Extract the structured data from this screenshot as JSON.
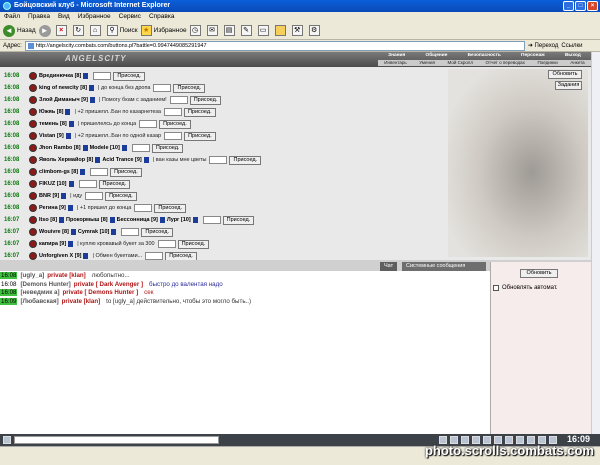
{
  "window": {
    "title": "Бойцовский клуб - Microsoft Internet Explorer"
  },
  "menu": [
    "Файл",
    "Правка",
    "Вид",
    "Избранное",
    "Сервис",
    "Справка"
  ],
  "toolbar": {
    "back_label": "Назад",
    "search_label": "Поиск",
    "favorites_label": "Избранное"
  },
  "address": {
    "label": "Адрес:",
    "url": "http://angelscity.combats.com/buttons.pl?battle=0.9947449085291947",
    "go_label": "Переход",
    "links_label": "Ссылки"
  },
  "site": {
    "logo": "ANGELSCITY",
    "nav": [
      "Знания",
      "Общение",
      "Безопасность",
      "Персонаж",
      "Выход"
    ],
    "subnav": [
      "Инвентарь",
      "Умения",
      "Мой Скролл",
      "Отчет о переводах",
      "Поединки",
      "Анкета"
    ]
  },
  "battle_rows": [
    {
      "time": "16:08",
      "players": [
        "Врединючка [8]"
      ],
      "message": "",
      "button": "Присоед."
    },
    {
      "time": "16:08",
      "players": [
        "king of newcity [8]"
      ],
      "message": "до конца без дропа",
      "button": "Присоед."
    },
    {
      "time": "16:08",
      "players": [
        "Злой Диманыч [9]"
      ],
      "message": "Помогу бкам с заданием!",
      "button": "Присоед."
    },
    {
      "time": "16:08",
      "players": [
        "Южяь [8]"
      ],
      "message": "+2 пришелл..Бан по казарнетеза",
      "button": "Присоед."
    },
    {
      "time": "16:08",
      "players": [
        "темень [8]"
      ],
      "message": "пришелелсь до конца",
      "button": "Присоед."
    },
    {
      "time": "16:08",
      "players": [
        "Vistan [9]"
      ],
      "message": "+2 пришелл..Бан по одной казар",
      "button": "Присоед."
    },
    {
      "time": "16:08",
      "players": [
        "Jhon Rambo [8]",
        "Modele [10]"
      ],
      "message": "",
      "button": "Присоед."
    },
    {
      "time": "16:08",
      "players": [
        "Яволь Хермайор [8]",
        "Acid Trance [9]"
      ],
      "message": "ван казы мне цветы",
      "button": "Присоед."
    },
    {
      "time": "16:08",
      "players": [
        "climbom-gs [8]"
      ],
      "message": "",
      "button": "Присоед."
    },
    {
      "time": "16:08",
      "players": [
        "FIKUZ [10]"
      ],
      "message": "",
      "button": "Присоед."
    },
    {
      "time": "16:08",
      "players": [
        "BNR [9]"
      ],
      "message": "иду",
      "button": "Присоед."
    },
    {
      "time": "16:08",
      "players": [
        "Регина [9]"
      ],
      "message": "+1 пришел до конца",
      "button": "Присоед."
    },
    {
      "time": "16:07",
      "players": [
        "Itso [8]",
        "Прокормыш [8]",
        "Бессонница [9]",
        "Лург [10]"
      ],
      "message": "",
      "button": "Присоед."
    },
    {
      "time": "16:07",
      "players": [
        "Wouivre [8]",
        "Cymrak [10]"
      ],
      "message": "",
      "button": "Присоед."
    },
    {
      "time": "16:07",
      "players": [
        "капира [9]"
      ],
      "message": "куплю кровавый букет за 300",
      "button": "Присоед."
    },
    {
      "time": "16:07",
      "players": [
        "Unforgiven X [9]"
      ],
      "message": "Обмен букетами...",
      "button": "Присоед."
    }
  ],
  "buttons": {
    "refresh": "Обновить",
    "tasks": "Задания",
    "refresh2": "Обновить",
    "auto_refresh": "Обновлять автомат."
  },
  "tabs": [
    "Чат",
    "Системные сообщения"
  ],
  "chat": [
    {
      "time": "16:08",
      "highlight": true,
      "who": "[ugly_a]",
      "priv": "private [klan]",
      "msg": "любопытно...",
      "msg_style": "dark"
    },
    {
      "time": "16:08",
      "highlight": false,
      "who": "[Demons Hunter]",
      "priv": "private [ Dark Avenger ]",
      "msg": "быстро до валентая надо",
      "msg_style": "blue"
    },
    {
      "time": "16:08",
      "highlight": true,
      "who": "[неведмик а]",
      "priv": "private [ Demons Hunter ]",
      "msg": "сек",
      "msg_style": "red"
    },
    {
      "time": "16:09",
      "highlight": true,
      "who": "[Любавская]",
      "priv": "private [klan]",
      "msg": "to [ugly_a] действительно, чтобы это могло быть..)",
      "msg_style": "dark"
    }
  ],
  "clock": "16:09",
  "watermark": "photo.scrolls.combats.com"
}
